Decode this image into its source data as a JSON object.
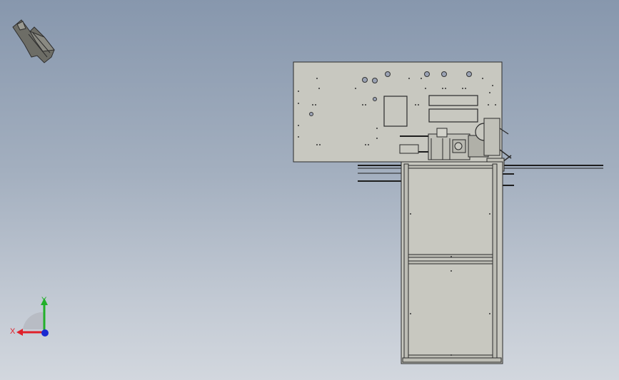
{
  "viewport": {
    "background_top": "#8797ad",
    "background_bottom": "#d2d7de",
    "model_fill": "#c8c8c0",
    "model_stroke": "#2a2a2a"
  },
  "triad": {
    "x_label": "X",
    "y_label": "Y",
    "x_color": "#e0202a",
    "y_color": "#22b02a",
    "z_color": "#1a2ad0"
  },
  "orientation_icon": "view-orientation-icon"
}
